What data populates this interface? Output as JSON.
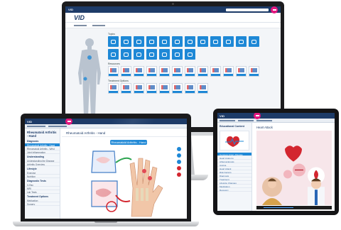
{
  "app": {
    "logo": "VID",
    "brand_color": "#1d3b68",
    "accent_color": "#1e88d6",
    "badge_color": "#e2177e"
  },
  "monitor": {
    "sections": [
      "Topics",
      "Resources",
      "Treatment Options"
    ],
    "topic_tile_icons": [
      "brain-icon",
      "lungs-icon",
      "dna-icon",
      "drop-icon",
      "bone-icon",
      "nerve-icon",
      "search-icon",
      "heart-icon",
      "stomach-icon",
      "kidney-icon",
      "ribbon-icon",
      "person-icon"
    ]
  },
  "laptop": {
    "sidebar_title": "Rheumatoid Arthritis - Hand",
    "sidebar_groups": [
      {
        "heading": "Diagnosis",
        "items": [
          "Rheumatoid Arthritis - Hand",
          "Rheumatoid Arthritis - Wrist",
          "Joint Inflammation"
        ]
      },
      {
        "heading": "Understanding",
        "items": [
          "Understanding the Disease",
          "Arthritis Overview"
        ]
      },
      {
        "heading": "Lifestyle",
        "items": [
          "Exercise",
          "Nutrition"
        ]
      },
      {
        "heading": "Diagnostic Tests",
        "items": [
          "X-Ray",
          "MRI",
          "Lab Tests"
        ]
      },
      {
        "heading": "Treatment Options",
        "items": [
          "Medication",
          "Surgery"
        ]
      }
    ],
    "active_item": "Rheumatoid Arthritis - Hand",
    "main_title": "Rheumatoid Arthritis - Hand",
    "figure_label": "Rheumatoid Arthritis - Hand"
  },
  "tablet": {
    "sidebar_heading": "Educational Content",
    "card_text": "Coronary Artery Disease",
    "items": [
      "Coronary Artery Disease",
      "Heart Anatomy",
      "Atherosclerosis",
      "Angina",
      "Heart Attack",
      "Risk Factors",
      "Diagnosis",
      "Treatment",
      "Lifestyle Changes",
      "Medication",
      "Recovery"
    ],
    "active_item": "Coronary Artery Disease",
    "main_title": "Heart Attack",
    "video_progress": 0.4
  }
}
